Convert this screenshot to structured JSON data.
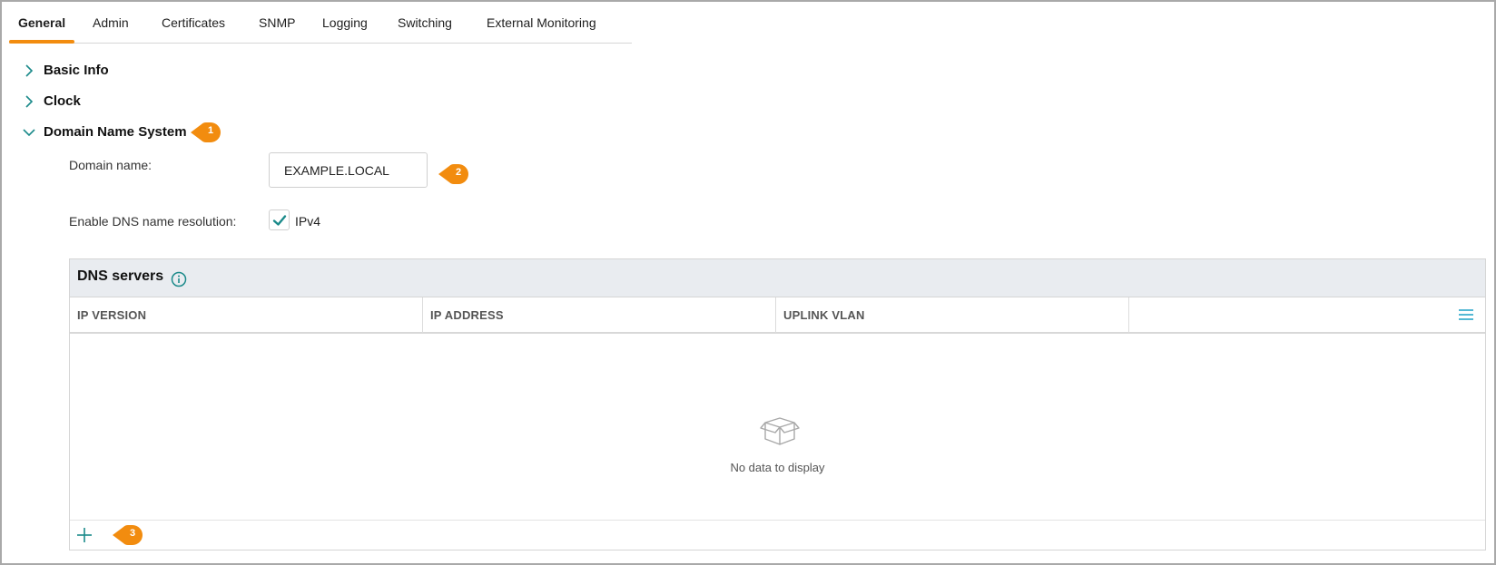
{
  "tabs": [
    {
      "label": "General",
      "active": true
    },
    {
      "label": "Admin"
    },
    {
      "label": "Certificates"
    },
    {
      "label": "SNMP"
    },
    {
      "label": "Logging"
    },
    {
      "label": "Switching"
    },
    {
      "label": "External Monitoring"
    }
  ],
  "sections": {
    "basic_info": {
      "title": "Basic Info",
      "expanded": false
    },
    "clock": {
      "title": "Clock",
      "expanded": false
    },
    "dns": {
      "title": "Domain Name System",
      "expanded": true
    }
  },
  "form": {
    "domain_label": "Domain name:",
    "domain_value": "EXAMPLE.LOCAL",
    "dns_resolution_label": "Enable DNS name resolution:",
    "ipv4_label": "IPv4",
    "ipv4_checked": true
  },
  "dns_servers": {
    "title": "DNS servers",
    "columns": [
      "IP VERSION",
      "IP ADDRESS",
      "UPLINK VLAN",
      ""
    ],
    "empty_text": "No data to display",
    "rows": []
  },
  "callouts": [
    "1",
    "2",
    "3"
  ],
  "colors": {
    "accent": "#f28c0f",
    "teal": "#1b8a8a",
    "menu_icon": "#2aa7c9",
    "header_bg": "#e9ecf0"
  },
  "icons": [
    "chevron-right-icon",
    "chevron-down-icon",
    "check-icon",
    "info-icon",
    "menu-icon",
    "empty-box-icon",
    "plus-icon"
  ]
}
